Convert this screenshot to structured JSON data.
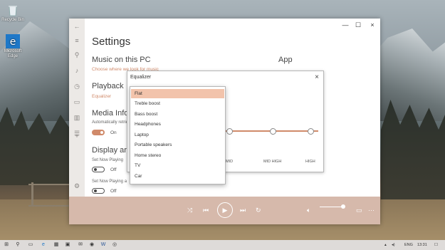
{
  "desktop": {
    "icons": [
      {
        "label": "Recycle Bin",
        "icon": "recycle-bin-icon"
      },
      {
        "label": "Microsoft Edge",
        "icon": "edge-icon"
      }
    ]
  },
  "settings": {
    "title": "Settings",
    "sections": {
      "music": {
        "heading": "Music on this PC",
        "link": "Choose where we look for music"
      },
      "app": {
        "heading": "App"
      },
      "playback": {
        "heading": "Playback",
        "link": "Equalizer"
      },
      "media_info": {
        "heading": "Media Info",
        "desc": "Automatically retrieve",
        "toggle": "On"
      },
      "display_art": {
        "heading": "Display art",
        "item1": "Set Now Playing",
        "item1_toggle": "Off",
        "item2": "Set Now Playing a",
        "item2_toggle": "Off"
      }
    }
  },
  "equalizer": {
    "title": "Equalizer",
    "close": "×",
    "bands": [
      "MID",
      "MID HIGH",
      "HIGH"
    ],
    "presets": [
      "Flat",
      "Treble boost",
      "Bass boost",
      "Headphones",
      "Laptop",
      "Portable speakers",
      "Home stereo",
      "TV",
      "Car"
    ],
    "selected": "Flat"
  },
  "window": {
    "back": "←",
    "minimize": "—",
    "maximize": "☐",
    "close": "×"
  },
  "player": {
    "volume_level": 0.8
  },
  "taskbar": {
    "lang": "ENG",
    "time": "13:31"
  }
}
